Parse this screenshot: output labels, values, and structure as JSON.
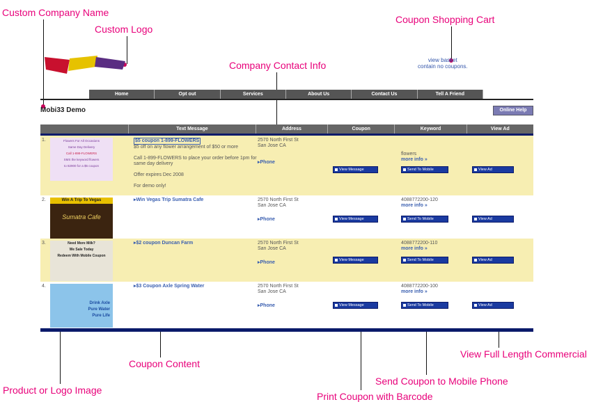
{
  "annotations": {
    "company_name": "Custom Company Name",
    "logo": "Custom Logo",
    "cart": "Coupon Shopping Cart",
    "contact": "Company Contact Info",
    "coupon_content": "Coupon Content",
    "product_image": "Product or Logo Image",
    "print_coupon": "Print Coupon with Barcode",
    "send_coupon": "Send Coupon to Mobile Phone",
    "view_ad": "View Full Length Commercial"
  },
  "cart": {
    "line1": "view basket",
    "line2": "contain no coupons."
  },
  "nav": [
    "Home",
    "Opt out",
    "Services",
    "About Us",
    "Contact Us",
    "Tell A Friend"
  ],
  "company": "Mobi33 Demo",
  "help": "Online Help",
  "columns": [
    "Text Message",
    "Address",
    "Coupon",
    "Keyword",
    "View Ad"
  ],
  "buttons": {
    "view_message": "View Message",
    "send_mobile": "Send To Mobile",
    "view_ad": "View Ad"
  },
  "links": {
    "phone": "Phone",
    "more_info": "more info »"
  },
  "rows": [
    {
      "num": "1.",
      "title": "$5 coupon 1-899-FLOWERS",
      "body": "$5 off on any flower arrangement of $50 or more",
      "body2": "Call 1-899-FLOWERS to place your order before 1pm for same day delivery",
      "body3": "Offer expires Dec 2008",
      "body4": "For demo only!",
      "address1": "2570 North First St",
      "address2": "San Jose CA",
      "keyword": "flowers",
      "thumb": {
        "line1": "Flowers For All Occasions",
        "line2": "Same Day Delivery",
        "line3": "Call 1-899-FLOWERS",
        "line4": "SMS the keyword flowers",
        "line5": "to 82900 for a $5 coupon"
      }
    },
    {
      "num": "2.",
      "title": "Win Vegas Trip Sumatra Cafe",
      "address1": "2570 North First St",
      "address2": "San Jose CA",
      "keyword": "4088772200-120",
      "thumb": {
        "line1": "Win A Trip To Vegas",
        "line2": "Sumatra Cafe"
      }
    },
    {
      "num": "3.",
      "title": "$2 coupon Duncan Farm",
      "address1": "2570 North First St",
      "address2": "San Jose CA",
      "keyword": "4088772200-110",
      "thumb": {
        "line1": "Need More Milk?",
        "line2": "We Sale Today",
        "line3": "Redeem With Mobile Coupon"
      }
    },
    {
      "num": "4.",
      "title": "$3 Coupon Axle Spring Water",
      "address1": "2570 North First St",
      "address2": "San Jose CA",
      "keyword": "4088772200-100",
      "thumb": {
        "line1": "Drink Axle",
        "line2": "Pure Water",
        "line3": "Pure Life"
      }
    }
  ]
}
